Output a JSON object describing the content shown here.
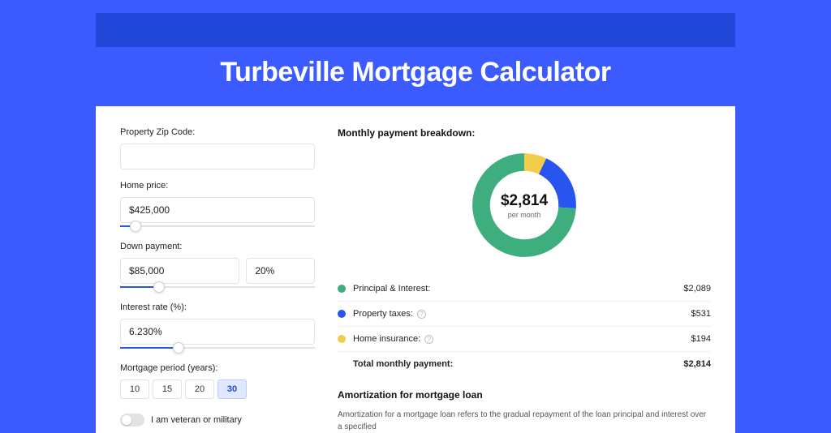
{
  "title": "Turbeville Mortgage Calculator",
  "form": {
    "zip_label": "Property Zip Code:",
    "zip_value": "",
    "home_label": "Home price:",
    "home_value": "$425,000",
    "home_slider_pct": 8,
    "down_label": "Down payment:",
    "down_value": "$85,000",
    "down_pct": "20%",
    "down_slider_pct": 20,
    "rate_label": "Interest rate (%):",
    "rate_value": "6.230%",
    "rate_slider_pct": 30,
    "period_label": "Mortgage period (years):",
    "periods": [
      "10",
      "15",
      "20",
      "30"
    ],
    "period_active_index": 3,
    "veteran_label": "I am veteran or military"
  },
  "breakdown": {
    "title": "Monthly payment breakdown:",
    "center_amount": "$2,814",
    "center_sub": "per month",
    "rows": [
      {
        "label": "Principal & Interest:",
        "value": "$2,089",
        "color": "#3fae7e",
        "pct": 74,
        "info": false
      },
      {
        "label": "Property taxes:",
        "value": "$531",
        "color": "#2855f0",
        "pct": 19,
        "info": true
      },
      {
        "label": "Home insurance:",
        "value": "$194",
        "color": "#f2cd4a",
        "pct": 7,
        "info": true
      }
    ],
    "total_label": "Total monthly payment:",
    "total_value": "$2,814"
  },
  "amort": {
    "title": "Amortization for mortgage loan",
    "text": "Amortization for a mortgage loan refers to the gradual repayment of the loan principal and interest over a specified"
  },
  "chart_data": {
    "type": "pie",
    "title": "Monthly payment breakdown",
    "total": 2814,
    "unit": "USD per month",
    "series": [
      {
        "name": "Principal & Interest",
        "value": 2089,
        "color": "#3fae7e"
      },
      {
        "name": "Property taxes",
        "value": 531,
        "color": "#2855f0"
      },
      {
        "name": "Home insurance",
        "value": 194,
        "color": "#f2cd4a"
      }
    ]
  }
}
